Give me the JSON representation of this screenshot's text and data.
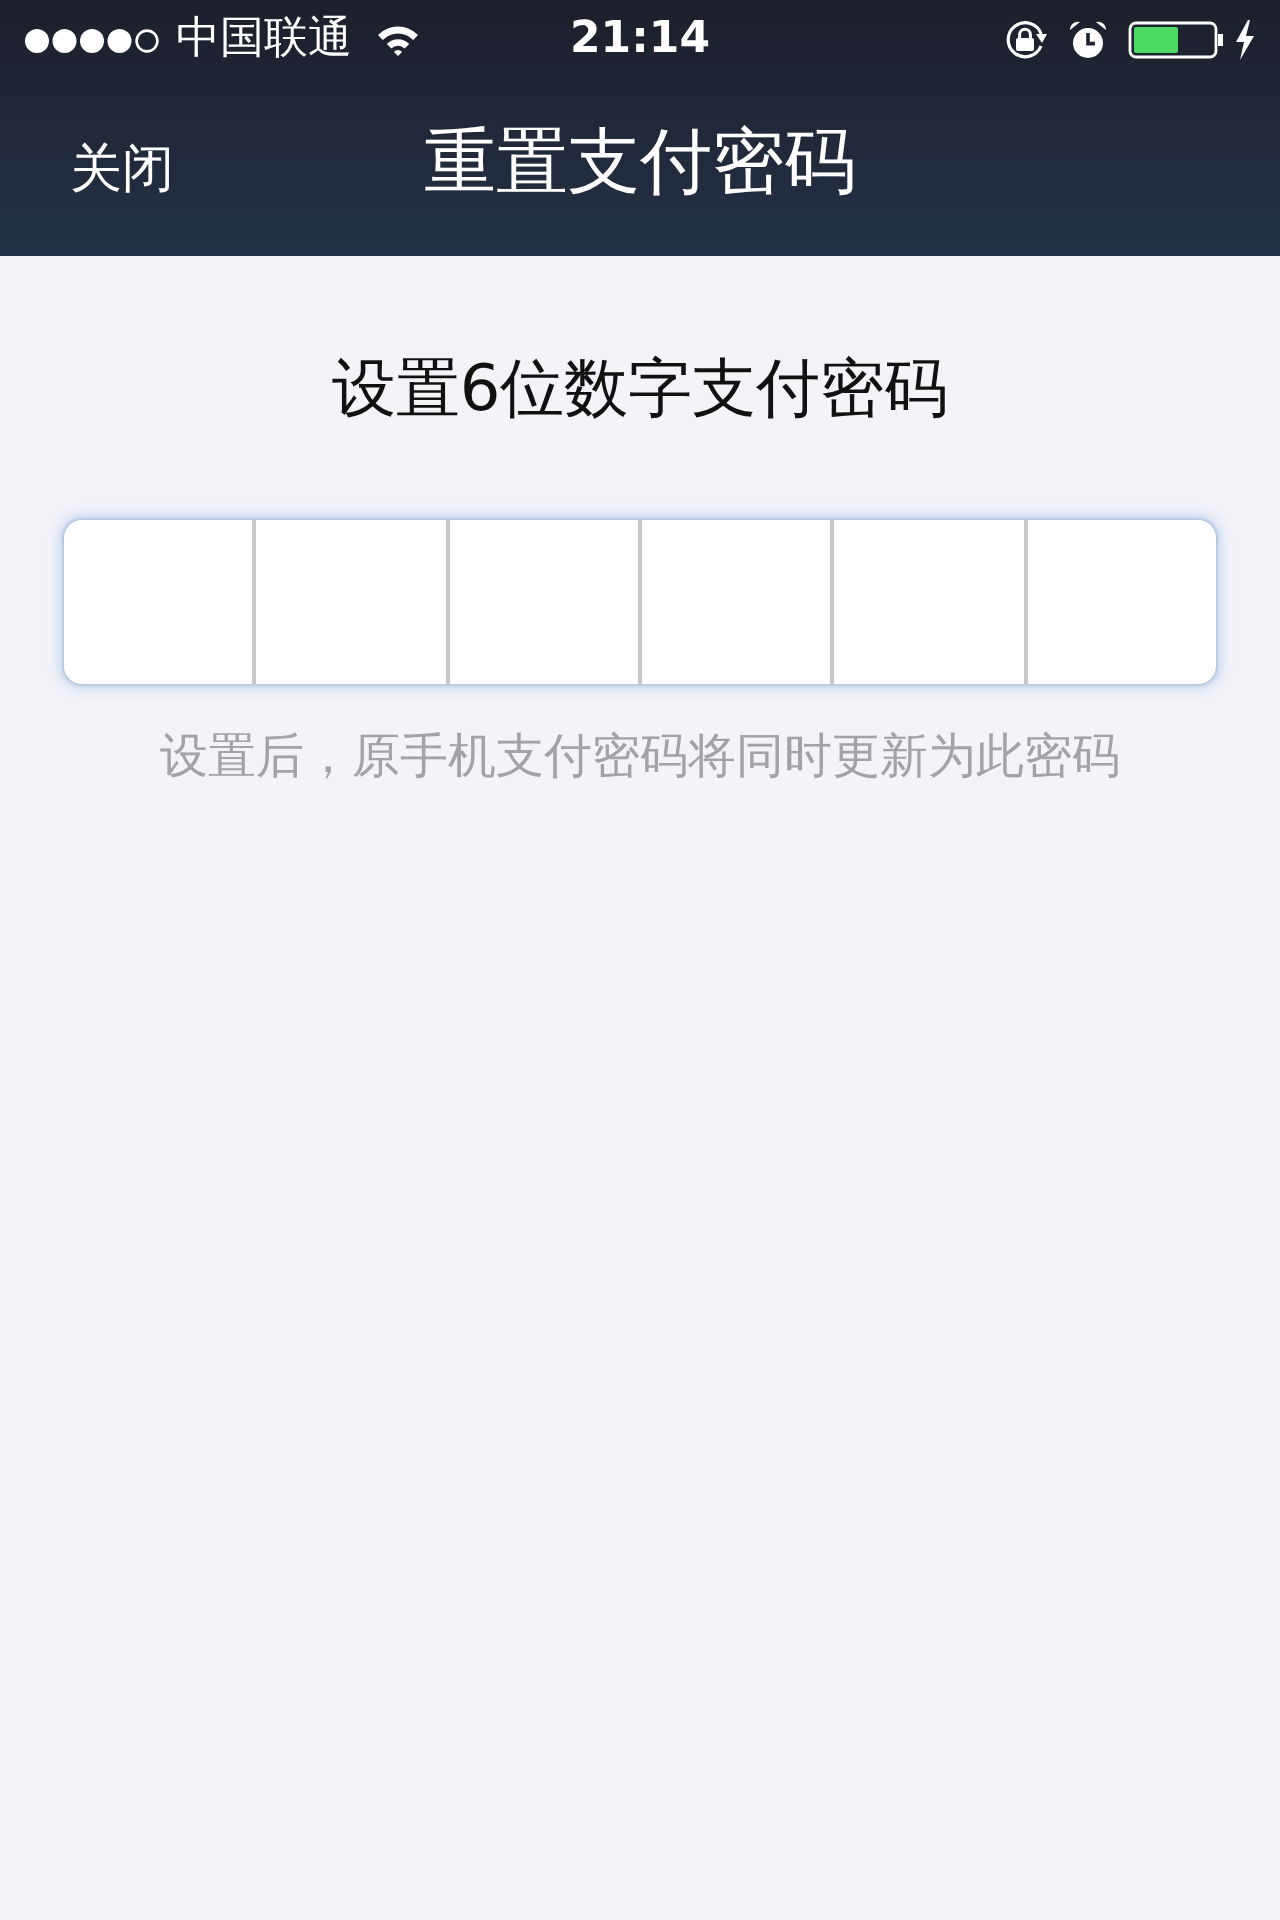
{
  "status_bar": {
    "carrier": "中国联通",
    "time": "21:14"
  },
  "nav_bar": {
    "close_button": "关闭",
    "title": "重置支付密码"
  },
  "prompt": "设置6位数字支付密码",
  "hint": "设置后，原手机支付密码将同时更新为此密码"
}
